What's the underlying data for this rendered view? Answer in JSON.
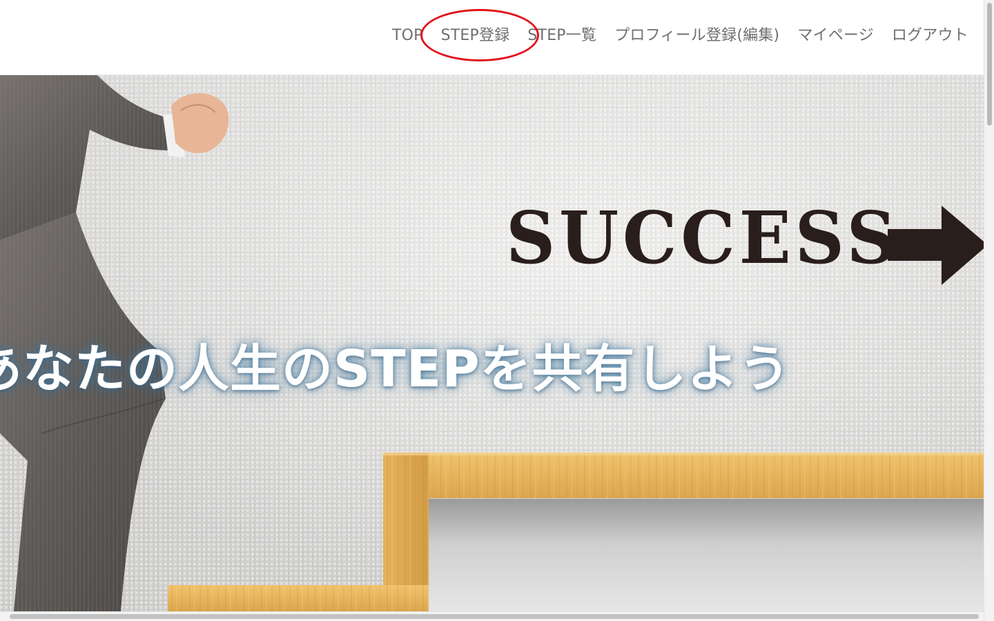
{
  "header": {
    "nav": [
      {
        "label": "TOP"
      },
      {
        "label": "STEP登録"
      },
      {
        "label": "STEP一覧"
      },
      {
        "label": "プロフィール登録(編集)"
      },
      {
        "label": "マイページ"
      },
      {
        "label": "ログアウト"
      }
    ],
    "highlighted_item": "STEP登録",
    "highlight_color": "#e2121c"
  },
  "hero": {
    "headline": "あなたの人生のSTEPを共有しよう",
    "image_word": "SUCCESS",
    "arrow_icon": "right-arrow-icon"
  },
  "colors": {
    "nav_text": "#6f6f6f",
    "stencil": "#2a1e1c",
    "wood": "#e8b65c"
  }
}
